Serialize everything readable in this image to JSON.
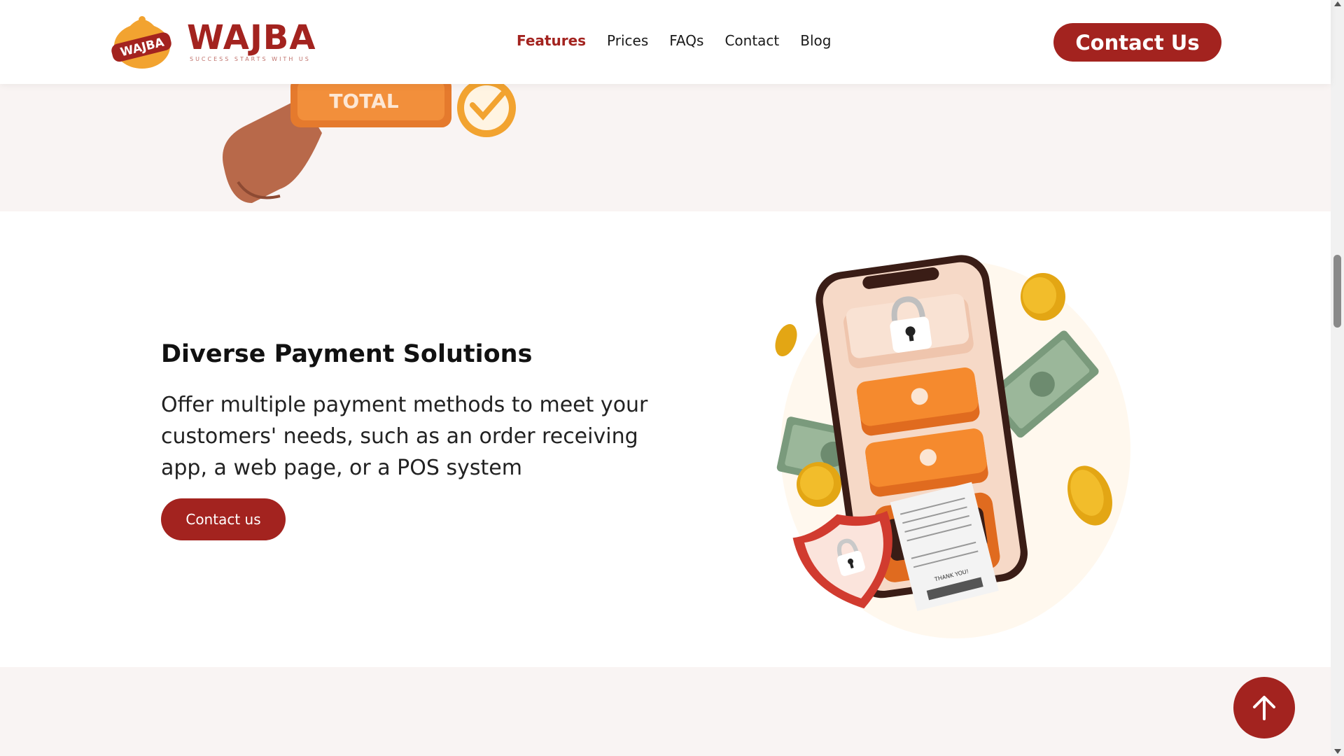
{
  "brand": {
    "name": "WAJBA",
    "badge_text": "WAJBA",
    "tagline": "SUCCESS STARTS WITH US",
    "color": "#a3231f",
    "accent_orange": "#f2a330"
  },
  "nav": {
    "items": [
      {
        "label": "Features",
        "active": true
      },
      {
        "label": "Prices",
        "active": false
      },
      {
        "label": "FAQs",
        "active": false
      },
      {
        "label": "Contact",
        "active": false
      },
      {
        "label": "Blog",
        "active": false
      }
    ]
  },
  "header": {
    "cta_label": "Contact Us"
  },
  "top_image": {
    "total_label": "TOTAL"
  },
  "feature": {
    "title": "Diverse Payment Solutions",
    "description": "Offer multiple payment methods to meet your customers' needs, such as an order receiving app, a web page, or a POS system",
    "cta_label": "Contact us"
  },
  "receipt": {
    "thank_you": "THANK YOU!"
  },
  "icons": {
    "back_to_top": "arrow-up-icon",
    "scroll_up": "scroll-up-arrow-icon",
    "scroll_down": "scroll-down-arrow-icon"
  }
}
